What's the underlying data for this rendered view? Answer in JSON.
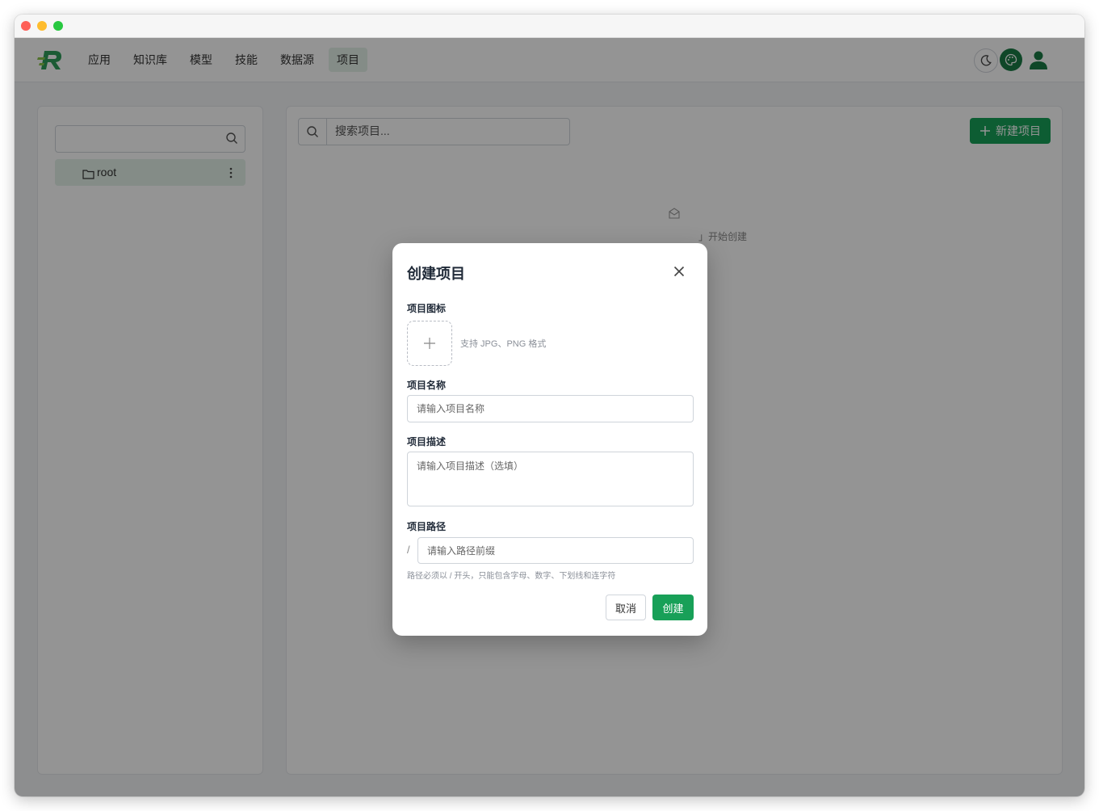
{
  "nav": {
    "items": [
      {
        "label": "应用"
      },
      {
        "label": "知识库"
      },
      {
        "label": "模型"
      },
      {
        "label": "技能"
      },
      {
        "label": "数据源"
      },
      {
        "label": "项目",
        "active": true
      }
    ],
    "icons": {
      "logo": "r-logo-icon",
      "theme": "moon-icon",
      "palette": "palette-icon",
      "user": "user-icon"
    }
  },
  "sidebar": {
    "search_placeholder": "",
    "tree": [
      {
        "label": "root",
        "icon": "folder-icon"
      }
    ]
  },
  "main": {
    "search_placeholder": "搜索项目...",
    "new_button_label": "新建项目",
    "empty_text_visible": "」开始创建"
  },
  "modal": {
    "title": "创建项目",
    "icon_label": "项目图标",
    "upload_hint": "支持 JPG、PNG 格式",
    "name_label": "项目名称",
    "name_placeholder": "请输入项目名称",
    "desc_label": "项目描述",
    "desc_placeholder": "请输入项目描述（选填）",
    "path_label": "项目路径",
    "path_prefix": "/",
    "path_placeholder": "请输入路径前缀",
    "path_hint": "路径必须以 / 开头，只能包含字母、数字、下划线和连字符",
    "cancel_label": "取消",
    "create_label": "创建"
  },
  "colors": {
    "accent": "#18a058",
    "active_nav_bg": "#e3f1e8",
    "palette_button": "#1b7a45"
  }
}
